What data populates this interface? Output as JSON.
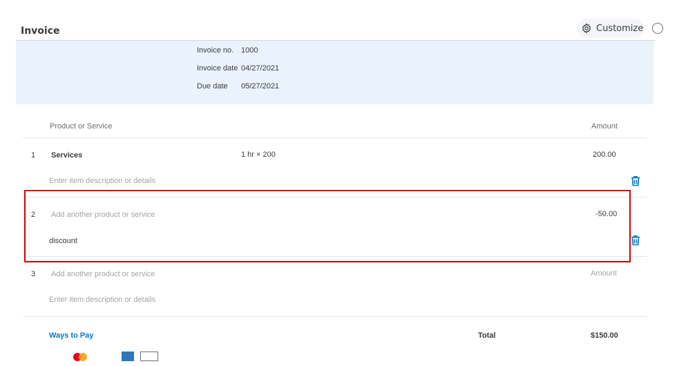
{
  "header": {
    "title": "Invoice",
    "customize_label": "Customize"
  },
  "meta": {
    "invoice_no_label": "Invoice no.",
    "invoice_no": "1000",
    "invoice_date_label": "Invoice date",
    "invoice_date": "04/27/2021",
    "due_date_label": "Due date",
    "due_date": "05/27/2021"
  },
  "table": {
    "col_product": "Product or Service",
    "col_amount": "Amount",
    "rows": [
      {
        "num": "1",
        "product": "Services",
        "qty_rate": "1 hr × 200",
        "amount": "200.00",
        "description_placeholder": "Enter item description or details"
      },
      {
        "num": "2",
        "product_placeholder": "Add another product or service",
        "amount": "-50.00",
        "description": "discount"
      },
      {
        "num": "3",
        "product_placeholder": "Add another product or service",
        "amount_placeholder": "Amount",
        "description_placeholder": "Enter item description or details"
      }
    ]
  },
  "footer": {
    "ways_to_pay": "Ways to Pay",
    "total_label": "Total",
    "total_value": "$150.00"
  },
  "colors": {
    "accent": "#0077c5",
    "highlight": "#d50000",
    "band": "#eaf2fb"
  },
  "icons": [
    "gear-icon",
    "help-icon",
    "trash-icon",
    "mastercard-icon",
    "amex-icon",
    "card-icon"
  ]
}
